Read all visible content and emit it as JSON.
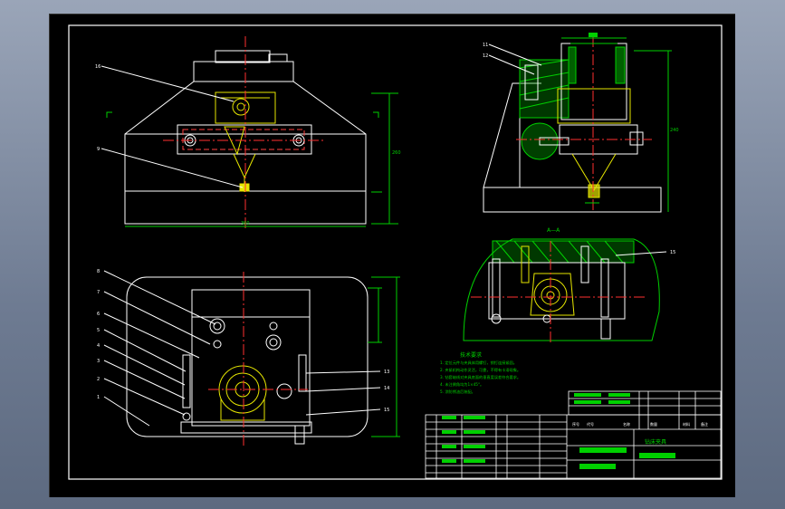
{
  "drawing": {
    "notes_title": "技术要求",
    "notes": [
      "1. 定位元件与夹具体用螺钉，销钉连接紧固。",
      "2. 夹紧机构动作灵活，可靠，不得有卡滞现象。",
      "3. 钻套轴线对夹具底面的垂直度误差符合要求。",
      "4. 未注倒角均为1×45°。",
      "5. 涂防锈油后装配。"
    ],
    "section_label": "A—A",
    "title_block": {
      "drawing_name": "钻床夹具",
      "headers": [
        "序号",
        "代号",
        "名称",
        "数量",
        "材料",
        "备注"
      ]
    },
    "balloons_front": [
      "16",
      "9"
    ],
    "balloons_side": [
      "11",
      "12"
    ],
    "balloons_plan": [
      "8",
      "7",
      "6",
      "5",
      "4",
      "3",
      "2",
      "1"
    ],
    "balloons_plan_right": [
      "13",
      "14",
      "15"
    ],
    "balloon_section": "15"
  }
}
